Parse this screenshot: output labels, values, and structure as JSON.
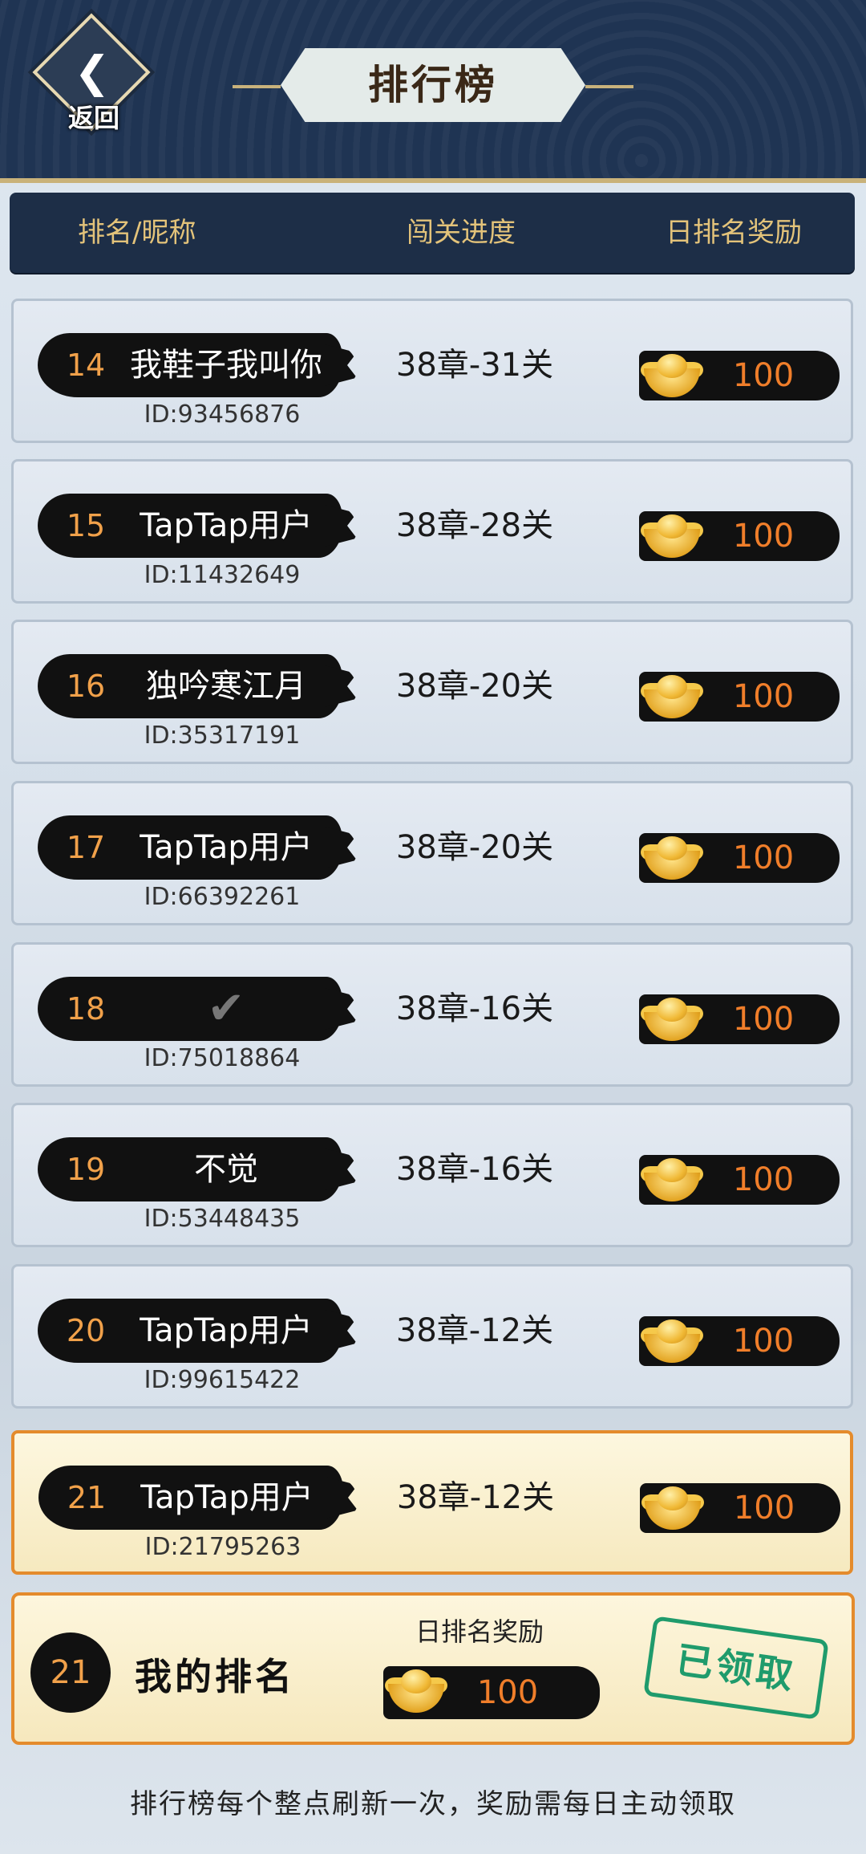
{
  "header": {
    "back_label": "返回",
    "title": "排行榜"
  },
  "columns": {
    "name": "排名/昵称",
    "progress": "闯关进度",
    "reward": "日排名奖励"
  },
  "rows": [
    {
      "rank": "14",
      "nickname": "我鞋子我叫你",
      "id": "ID:93456876",
      "progress": "38章-31关",
      "reward": "100"
    },
    {
      "rank": "15",
      "nickname": "TapTap用户",
      "id": "ID:11432649",
      "progress": "38章-28关",
      "reward": "100"
    },
    {
      "rank": "16",
      "nickname": "独吟寒江月",
      "id": "ID:35317191",
      "progress": "38章-20关",
      "reward": "100"
    },
    {
      "rank": "17",
      "nickname": "TapTap用户",
      "id": "ID:66392261",
      "progress": "38章-20关",
      "reward": "100"
    },
    {
      "rank": "18",
      "nickname": "✔",
      "id": "ID:75018864",
      "progress": "38章-16关",
      "reward": "100"
    },
    {
      "rank": "19",
      "nickname": "不觉",
      "id": "ID:53448435",
      "progress": "38章-16关",
      "reward": "100"
    },
    {
      "rank": "20",
      "nickname": "TapTap用户",
      "id": "ID:99615422",
      "progress": "38章-12关",
      "reward": "100"
    },
    {
      "rank": "21",
      "nickname": "TapTap用户",
      "id": "ID:21795263",
      "progress": "38章-12关",
      "reward": "100"
    }
  ],
  "my_rank": {
    "rank": "21",
    "label": "我的排名",
    "reward_title": "日排名奖励",
    "reward": "100",
    "status": "已领取"
  },
  "footer": "排行榜每个整点刷新一次，奖励需每日主动领取",
  "colors": {
    "header_bg": "#1f3453",
    "accent_orange": "#e48b2c",
    "rank_orange": "#f1a14a",
    "claimed_green": "#1f9b6c"
  },
  "icons": {
    "back": "back-arrow-icon",
    "reward": "gold-ingot-icon"
  }
}
